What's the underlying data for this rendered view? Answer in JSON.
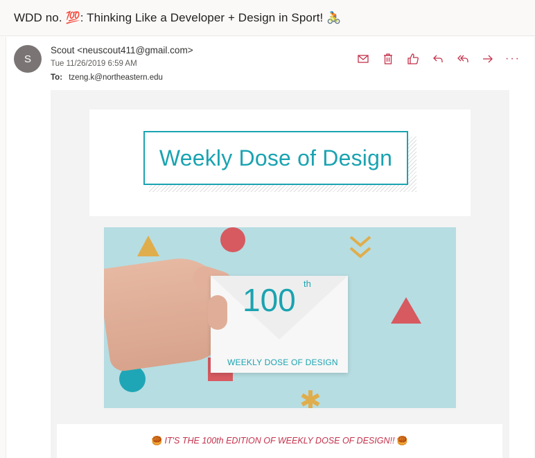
{
  "subject": {
    "text": "WDD no. 💯: Thinking Like a Developer + Design in Sport! 🚴"
  },
  "message": {
    "avatar_initial": "S",
    "sender": "Scout <neuscout411@gmail.com>",
    "date": "Tue 11/26/2019 6:59 AM",
    "to_label": "To:",
    "to_value": "tzeng.k@northeastern.edu"
  },
  "actions": [
    {
      "name": "mark-unread",
      "icon": "envelope-icon"
    },
    {
      "name": "delete",
      "icon": "trash-icon"
    },
    {
      "name": "like",
      "icon": "thumbs-up-icon"
    },
    {
      "name": "reply",
      "icon": "reply-icon"
    },
    {
      "name": "reply-all",
      "icon": "reply-all-icon"
    },
    {
      "name": "forward",
      "icon": "forward-icon"
    },
    {
      "name": "more",
      "icon": "more-icon",
      "label": "···"
    }
  ],
  "email_body": {
    "logo_text": "Weekly Dose of Design",
    "hero": {
      "number": "100",
      "superscript": "th",
      "envelope_label": "WEEKLY DOSE OF DESIGN"
    },
    "edition_line": "IT'S THE 100th EDITION OF WEEKLY DOSE OF DESIGN!!",
    "edition_emoji": "🥮"
  },
  "colors": {
    "accent": "#c4314b",
    "brand_teal": "#1aa3b1",
    "hero_bg": "#b6dde2"
  }
}
